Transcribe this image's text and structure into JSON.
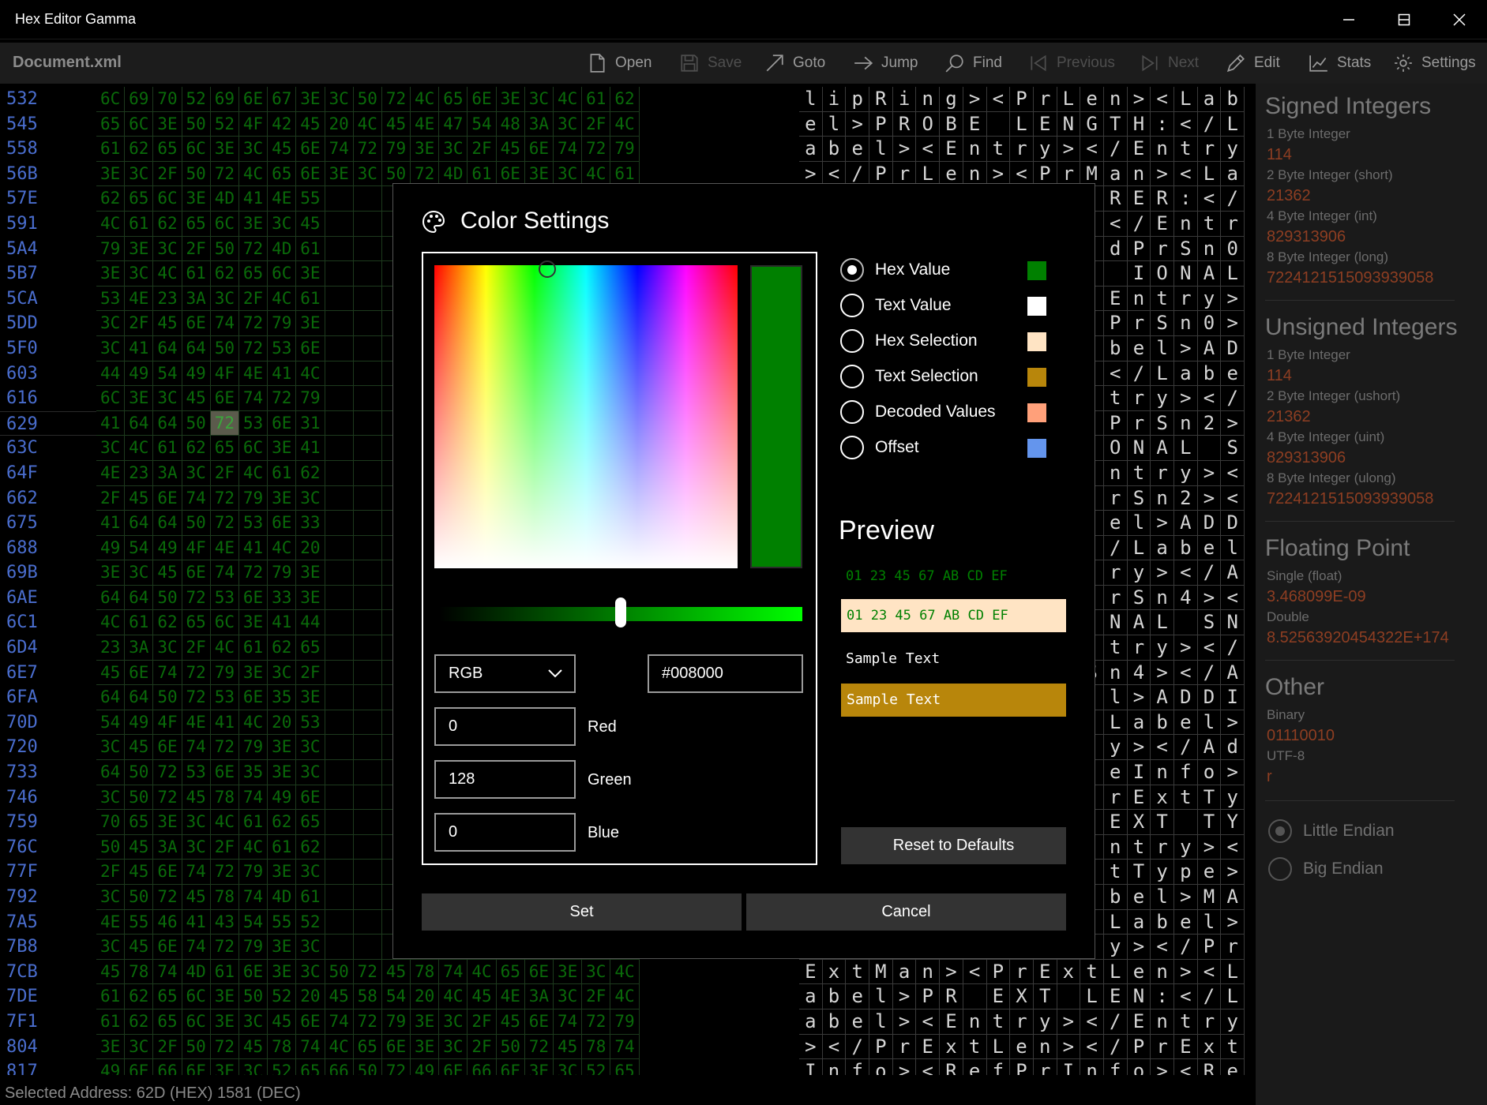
{
  "window": {
    "title": "Hex Editor Gamma"
  },
  "toolbar": {
    "document": "Document.xml",
    "buttons": [
      {
        "label": "Open",
        "icon": "open-file-icon",
        "enabled": true
      },
      {
        "label": "Save",
        "icon": "save-icon",
        "enabled": false
      },
      {
        "label": "Goto",
        "icon": "goto-arrow-icon",
        "enabled": true
      },
      {
        "label": "Jump",
        "icon": "jump-arrow-icon",
        "enabled": true
      },
      {
        "label": "Find",
        "icon": "search-icon",
        "enabled": true
      },
      {
        "label": "Previous",
        "icon": "previous-icon",
        "enabled": false
      },
      {
        "label": "Next",
        "icon": "next-icon",
        "enabled": false
      },
      {
        "label": "Edit",
        "icon": "pencil-icon",
        "enabled": true
      },
      {
        "label": "Stats",
        "icon": "chart-icon",
        "enabled": true
      },
      {
        "label": "Settings",
        "icon": "gear-icon",
        "enabled": true
      }
    ]
  },
  "editor": {
    "offsets": [
      "532",
      "545",
      "558",
      "56B",
      "57E",
      "591",
      "5A4",
      "5B7",
      "5CA",
      "5DD",
      "5F0",
      "603",
      "616",
      "629",
      "63C",
      "64F",
      "662",
      "675",
      "688",
      "69B",
      "6AE",
      "6C1",
      "6D4",
      "6E7",
      "6FA",
      "70D",
      "720",
      "733",
      "746",
      "759",
      "76C",
      "77F",
      "792",
      "7A5",
      "7B8",
      "7CB",
      "7DE",
      "7F1",
      "804",
      "817"
    ],
    "hex_rows": [
      "6C 69 70 52 69 6E 67 3E 3C 50 72 4C 65 6E 3E 3C 4C 61 62",
      "65 6C 3E 50 52 4F 42 45 20 4C 45 4E 47 54 48 3A 3C 2F 4C",
      "61 62 65 6C 3E 3C 45 6E 74 72 79 3E 3C 2F 45 6E 74 72 79",
      "3E 3C 2F 50 72 4C 65 6E 3E 3C 50 72 4D 61 6E 3E 3C 4C 61",
      "62 65 6C 3E 4D 41 4E 55",
      "4C 61 62 65 6C 3E 3C 45",
      "79 3E 3C 2F 50 72 4D 61",
      "3E 3C 4C 61 62 65 6C 3E",
      "53 4E 23 3A 3C 2F 4C 61",
      "3C 2F 45 6E 74 72 79 3E",
      "3C 41 64 64 50 72 53 6E",
      "44 49 54 49 4F 4E 41 4C",
      "6C 3E 3C 45 6E 74 72 79",
      "41 64 64 50 72 53 6E 31",
      "3C 4C 61 62 65 6C 3E 41",
      "4E 23 3A 3C 2F 4C 61 62",
      "2F 45 6E 74 72 79 3E 3C",
      "41 64 64 50 72 53 6E 33",
      "49 54 49 4F 4E 41 4C 20",
      "3E 3C 45 6E 74 72 79 3E",
      "64 64 50 72 53 6E 33 3E",
      "4C 61 62 65 6C 3E 41 44",
      "23 3A 3C 2F 4C 61 62 65",
      "45 6E 74 72 79 3E 3C 2F",
      "64 64 50 72 53 6E 35 3E",
      "54 49 4F 4E 41 4C 20 53",
      "3C 45 6E 74 72 79 3E 3C",
      "64 50 72 53 6E 35 3E 3C",
      "3C 50 72 45 78 74 49 6E",
      "70 65 3E 3C 4C 61 62 65",
      "50 45 3A 3C 2F 4C 61 62",
      "2F 45 6E 74 72 79 3E 3C",
      "3C 50 72 45 78 74 4D 61",
      "4E 55 46 41 43 54 55 52",
      "3C 45 6E 74 72 79 3E 3C",
      "45 78 74 4D 61 6E 3E 3C 50 72 45 78 74 4C 65 6E 3E 3C 4C",
      "61 62 65 6C 3E 50 52 20 45 58 54 20 4C 45 4E 3A 3C 2F 4C",
      "61 62 65 6C 3E 3C 45 6E 74 72 79 3E 3C 2F 45 6E 74 72 79",
      "3E 3C 2F 50 72 45 78 74 4C 65 6E 3E 3C 2F 50 72 45 78 74",
      "49 6E 66 6F 3E 3C 52 65 66 50 72 49 6E 66 6F 3E 3C 52 65"
    ],
    "text_rows": [
      "lipRing><PrLen><Lab",
      "el>PROBE LENGTH:</L",
      "abel><Entry></Entry",
      "></PrLen><PrMan><La",
      "RER:</",
      "</Entr",
      "dPrSn0",
      "IONAL",
      "Entry>",
      "PrSn0>",
      "bel>AD",
      "</Labe",
      "try></",
      "PrSn2>",
      "ONAL S",
      "ntry><",
      "rSn2><",
      "el>ADD",
      "/Label",
      "ry></A",
      "rSn4><",
      "NAL SN",
      "try></",
      "Sn4></A",
      "l>ADDI",
      "Label>",
      "y></Ad",
      "eInfo>",
      "rExtTy",
      "EXT TY",
      "ntry><",
      "tType>",
      "bel>MA",
      "Label>",
      "y></Pr",
      "ExtMan><PrExtLen><L",
      "abel>PR EXT LEN:</L",
      "abel><Entry></Entry",
      "></PrExtLen></PrExt",
      "Info><RefPrInfo><Re"
    ],
    "status": "Selected Address: 62D (HEX) 1581 (DEC)"
  },
  "panel": {
    "signed": {
      "title": "Signed Integers",
      "items": [
        {
          "label": "1 Byte Integer",
          "value": "114"
        },
        {
          "label": "2 Byte Integer (short)",
          "value": "21362"
        },
        {
          "label": "4 Byte Integer (int)",
          "value": "829313906"
        },
        {
          "label": "8 Byte Integer (long)",
          "value": "7224121515093939058"
        }
      ]
    },
    "unsigned": {
      "title": "Unsigned Integers",
      "items": [
        {
          "label": "1 Byte Integer",
          "value": "114"
        },
        {
          "label": "2 Byte Integer (ushort)",
          "value": "21362"
        },
        {
          "label": "4 Byte Integer (uint)",
          "value": "829313906"
        },
        {
          "label": "8 Byte Integer (ulong)",
          "value": "7224121515093939058"
        }
      ]
    },
    "floating": {
      "title": "Floating Point",
      "items": [
        {
          "label": "Single (float)",
          "value": "3.468099E-09"
        },
        {
          "label": "Double",
          "value": "8.52563920454322E+174"
        }
      ]
    },
    "other": {
      "title": "Other",
      "items": [
        {
          "label": "Binary",
          "value": "01110010"
        },
        {
          "label": "UTF-8",
          "value": "r"
        }
      ]
    },
    "endian": {
      "little": "Little Endian",
      "big": "Big Endian",
      "selected": "little"
    }
  },
  "dialog": {
    "title": "Color Settings",
    "current_color": "#008000",
    "model": "RGB",
    "hex": "#008000",
    "red": {
      "value": "0",
      "label": "Red"
    },
    "green": {
      "value": "128",
      "label": "Green"
    },
    "blue": {
      "value": "0",
      "label": "Blue"
    },
    "slider_level": 0.5,
    "options": [
      {
        "label": "Hex Value",
        "color": "#008000",
        "selected": true
      },
      {
        "label": "Text Value",
        "color": "#FFFFFF",
        "selected": false
      },
      {
        "label": "Hex Selection",
        "color": "#FFE4C4",
        "selected": false
      },
      {
        "label": "Text Selection",
        "color": "#B8860B",
        "selected": false
      },
      {
        "label": "Decoded Values",
        "color": "#FFA07A",
        "selected": false
      },
      {
        "label": "Offset",
        "color": "#6495ED",
        "selected": false
      }
    ],
    "preview": {
      "title": "Preview",
      "hex": "01 23 45 67 AB CD EF",
      "text": "Sample Text"
    },
    "reset_label": "Reset to Defaults",
    "set_label": "Set",
    "cancel_label": "Cancel"
  }
}
